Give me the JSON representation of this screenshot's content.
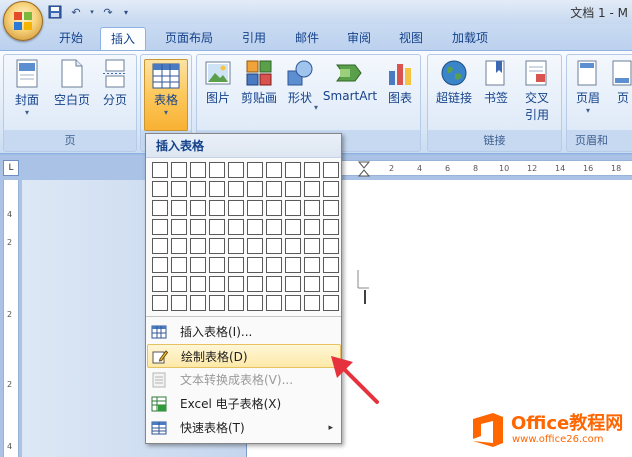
{
  "window": {
    "title": "文档 1 - M"
  },
  "tabs": [
    "开始",
    "插入",
    "页面布局",
    "引用",
    "邮件",
    "审阅",
    "视图",
    "加载项"
  ],
  "active_tab": "插入",
  "ribbon": {
    "pages_group": {
      "label": "页",
      "cover": "封面",
      "blank": "空白页",
      "break": "分页"
    },
    "table_group": {
      "table": "表格"
    },
    "illus_group": {
      "picture": "图片",
      "clipart": "剪贴画",
      "shapes": "形状",
      "smartart": "SmartArt",
      "chart": "图表"
    },
    "links_group": {
      "label": "链接",
      "hyperlink": "超链接",
      "bookmark": "书签",
      "crossref_l1": "交叉",
      "crossref_l2": "引用"
    },
    "header_group": {
      "label": "页眉和",
      "header": "页眉",
      "page": "页"
    }
  },
  "dropdown": {
    "header": "插入表格",
    "grid_rows": 8,
    "grid_cols": 10,
    "items": [
      {
        "label": "插入表格(I)...",
        "icon": "insert-table-icon",
        "state": "normal"
      },
      {
        "label": "绘制表格(D)",
        "icon": "draw-table-icon",
        "state": "hover"
      },
      {
        "label": "文本转换成表格(V)...",
        "icon": "convert-text-icon",
        "state": "disabled"
      },
      {
        "label": "Excel 电子表格(X)",
        "icon": "excel-icon",
        "state": "normal"
      },
      {
        "label": "快速表格(T)",
        "icon": "quick-table-icon",
        "state": "normal",
        "submenu": "▸"
      }
    ]
  },
  "ruler": {
    "corner": "L",
    "h_ticks": [
      "2",
      "4",
      "6",
      "8",
      "10",
      "12",
      "14",
      "16",
      "18"
    ],
    "v_ticks": [
      "4",
      "2",
      "2",
      "2",
      "4"
    ]
  },
  "watermark": {
    "title": "Office教程网",
    "url": "www.office26.com"
  },
  "colors": {
    "accent": "#fcc85c",
    "annotation_arrow": "#e6323c",
    "watermark": "#ff6600"
  }
}
